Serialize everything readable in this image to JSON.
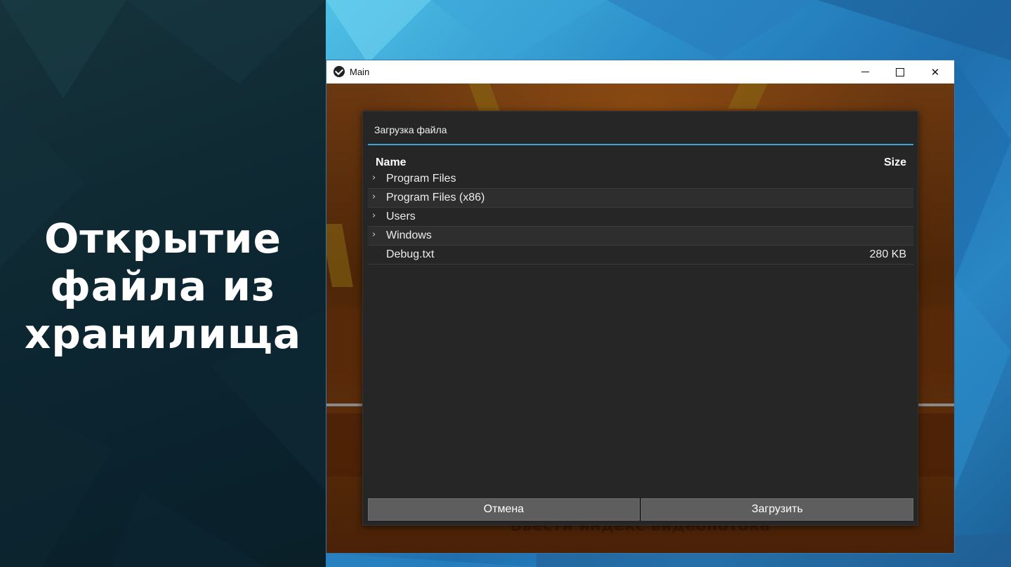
{
  "slide": {
    "title": "Открытие\nфайла из\nхранилища"
  },
  "window": {
    "title": "Main",
    "icon": "kivy-logo-icon",
    "controls": [
      "minimize-icon",
      "maximize-icon",
      "close-icon"
    ],
    "close_glyph": "✕"
  },
  "dialog": {
    "title": "Загрузка файла",
    "accent_color": "#39a6d6",
    "columns": {
      "name": "Name",
      "size": "Size"
    },
    "items": [
      {
        "name": "Program Files",
        "type": "folder",
        "size": ""
      },
      {
        "name": "Program Files (x86)",
        "type": "folder",
        "size": ""
      },
      {
        "name": "Users",
        "type": "folder",
        "size": ""
      },
      {
        "name": "Windows",
        "type": "folder",
        "size": ""
      },
      {
        "name": "Debug.txt",
        "type": "file",
        "size": "280 KB"
      }
    ],
    "chevron_glyph": "›",
    "buttons": {
      "cancel": "Отмена",
      "upload": "Загрузить"
    }
  },
  "background_app": {
    "bottom_text": "Ввести индекс видеопотока"
  }
}
